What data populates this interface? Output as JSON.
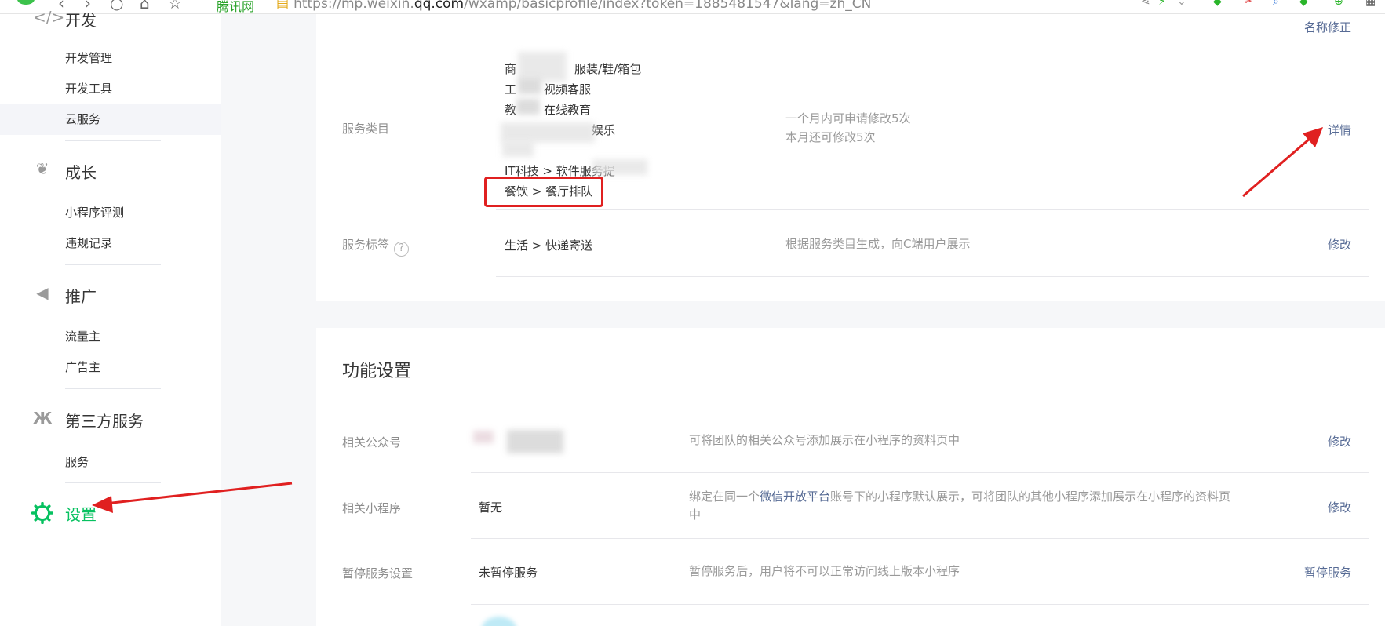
{
  "browser": {
    "site_label": "腾讯网",
    "url_prefix": "https://mp.weixin.",
    "url_domain": "qq.com",
    "url_suffix": "/wxamp/basicprofile/index?token=1885481547&lang=zh_CN"
  },
  "sidebar": {
    "sections": [
      {
        "title": "开发",
        "icon": "code-icon",
        "items": [
          "开发管理",
          "开发工具",
          "云服务"
        ]
      },
      {
        "title": "成长",
        "icon": "sprout-icon",
        "items": [
          "小程序评测",
          "违规记录"
        ]
      },
      {
        "title": "推广",
        "icon": "megaphone-icon",
        "items": [
          "流量主",
          "广告主"
        ]
      },
      {
        "title": "第三方服务",
        "icon": "third-party-icon",
        "items": [
          "服务"
        ]
      }
    ],
    "settings_label": "设置",
    "accent": "#07c160"
  },
  "top_card": {
    "name_fix_link": "名称修正",
    "service_category": {
      "label": "服务类目",
      "values": [
        "商",
        "服装/鞋/箱包",
        "工",
        "视频客服",
        "教",
        "在线教育",
        "娱乐",
        "IT科技 > 软件服务提",
        "餐饮 > 餐厅排队"
      ],
      "desc_line1": "一个月内可申请修改5次",
      "desc_line2": "本月还可修改5次",
      "link": "详情"
    },
    "service_tag": {
      "label": "服务标签",
      "help": "?",
      "value": "生活 > 快递寄送",
      "desc": "根据服务类目生成，向C端用户展示",
      "link": "修改"
    }
  },
  "func_card": {
    "title": "功能设置",
    "rows": [
      {
        "label": "相关公众号",
        "value": "",
        "desc": "可将团队的相关公众号添加展示在小程序的资料页中",
        "link": "修改"
      },
      {
        "label": "相关小程序",
        "value": "暂无",
        "desc_pre": "绑定在同一个",
        "desc_link": "微信开放平台",
        "desc_post": "账号下的小程序默认展示，可将团队的其他小程序添加展示在小程序的资料页",
        "desc_line2": "中",
        "link": "修改"
      },
      {
        "label": "暂停服务设置",
        "value": "未暂停服务",
        "desc": "暂停服务后，用户将不可以正常访问线上版本小程序",
        "link": "暂停服务"
      }
    ]
  },
  "colors": {
    "link": "#576b95",
    "annotation": "#e02020"
  }
}
